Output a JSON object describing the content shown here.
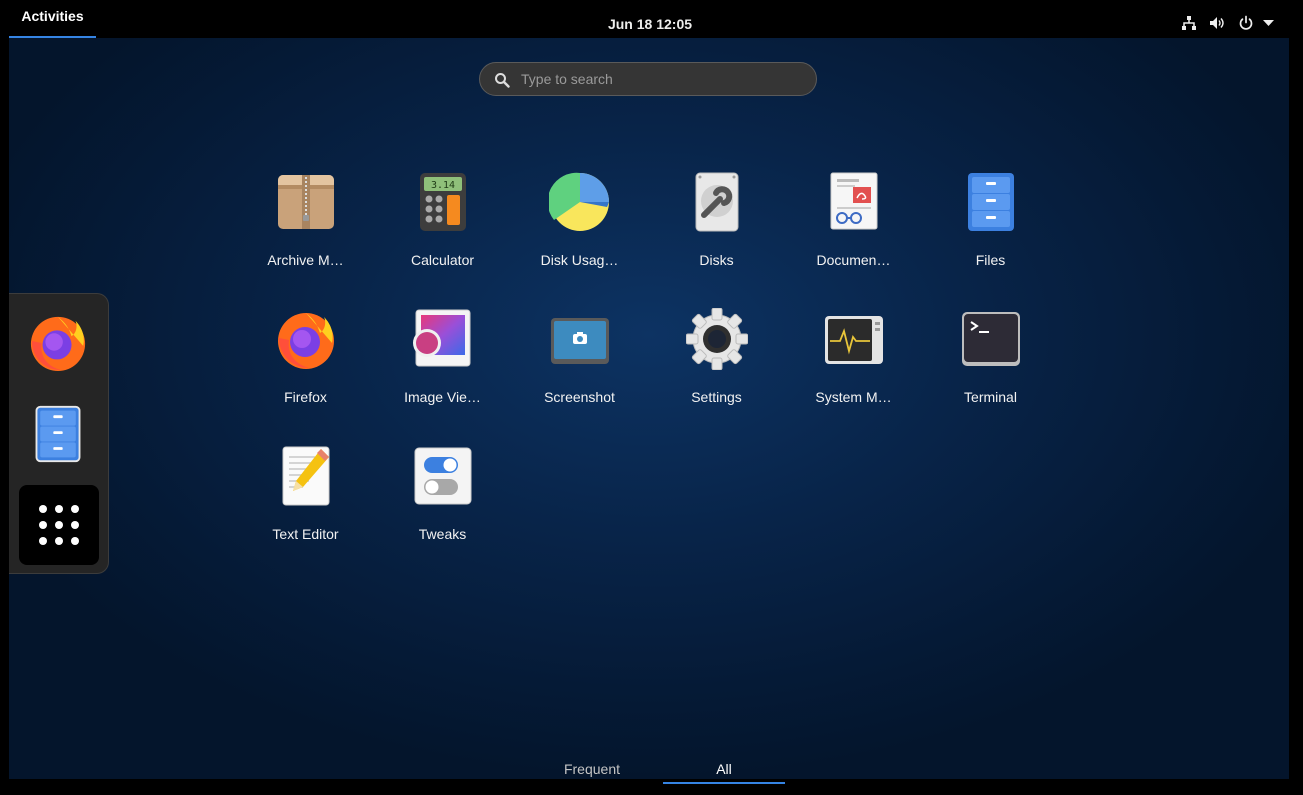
{
  "topbar": {
    "activities": "Activities",
    "clock": "Jun 18  12:05",
    "system_icons": [
      "network-icon",
      "volume-icon",
      "power-icon",
      "menu-arrow-icon"
    ]
  },
  "search": {
    "placeholder": "Type to search"
  },
  "apps": [
    {
      "label": "Archive M…",
      "icon": "archive-manager-icon"
    },
    {
      "label": "Calculator",
      "icon": "calculator-icon"
    },
    {
      "label": "Disk Usag…",
      "icon": "disk-usage-icon"
    },
    {
      "label": "Disks",
      "icon": "disks-icon"
    },
    {
      "label": "Documen…",
      "icon": "document-viewer-icon"
    },
    {
      "label": "Files",
      "icon": "files-icon"
    },
    {
      "label": "Firefox",
      "icon": "firefox-icon"
    },
    {
      "label": "Image Vie…",
      "icon": "image-viewer-icon"
    },
    {
      "label": "Screenshot",
      "icon": "screenshot-icon"
    },
    {
      "label": "Settings",
      "icon": "settings-icon"
    },
    {
      "label": "System M…",
      "icon": "system-monitor-icon"
    },
    {
      "label": "Terminal",
      "icon": "terminal-icon"
    },
    {
      "label": "Text Editor",
      "icon": "text-editor-icon"
    },
    {
      "label": "Tweaks",
      "icon": "tweaks-icon"
    }
  ],
  "calculator_display": "3.14",
  "dash": {
    "items": [
      "firefox-icon",
      "files-icon",
      "show-apps-icon"
    ]
  },
  "tabs": {
    "frequent": "Frequent",
    "all": "All",
    "selected": "All"
  },
  "colors": {
    "accent": "#3584e4",
    "panel": "#000000"
  }
}
